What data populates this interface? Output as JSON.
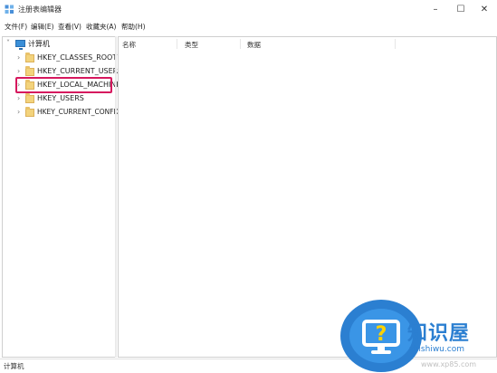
{
  "window": {
    "title": "注册表编辑器",
    "controls": {
      "minimize": "–",
      "maximize": "☐",
      "close": "✕"
    }
  },
  "menubar": {
    "items": [
      "文件(F)",
      "编辑(E)",
      "查看(V)",
      "收藏夹(A)",
      "帮助(H)"
    ]
  },
  "tree": {
    "root": {
      "label": "计算机",
      "expanded": true,
      "icon": "computer-icon"
    },
    "children": [
      {
        "label": "HKEY_CLASSES_ROOT",
        "icon": "folder-icon"
      },
      {
        "label": "HKEY_CURRENT_USER",
        "icon": "folder-icon"
      },
      {
        "label": "HKEY_LOCAL_MACHINE",
        "icon": "folder-icon",
        "highlighted": true
      },
      {
        "label": "HKEY_USERS",
        "icon": "folder-icon"
      },
      {
        "label": "HKEY_CURRENT_CONFIG",
        "icon": "folder-icon"
      }
    ]
  },
  "list": {
    "columns": [
      "名称",
      "类型",
      "数据"
    ]
  },
  "status": {
    "path": "计算机"
  },
  "watermark": {
    "brand": "知识屋",
    "url": "zhishiwu.com",
    "url2": "www.xp85.com"
  },
  "colors": {
    "highlight": "#d6185e",
    "accent": "#2b7fd1",
    "folder": "#f3d37c"
  }
}
